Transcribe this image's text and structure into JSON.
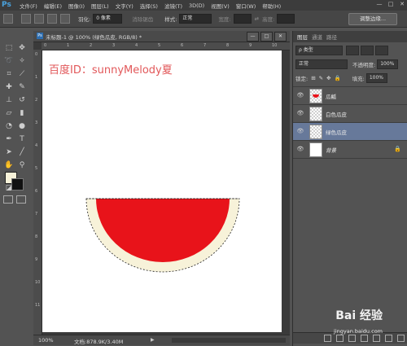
{
  "app": {
    "logo": "Ps"
  },
  "menu": [
    "文件(F)",
    "编辑(E)",
    "图像(I)",
    "图层(L)",
    "文字(Y)",
    "选择(S)",
    "滤镜(T)",
    "3D(D)",
    "视图(V)",
    "窗口(W)",
    "帮助(H)"
  ],
  "window_controls": {
    "minimize": "—",
    "restore": "□",
    "close": "✕"
  },
  "options": {
    "feather_label": "羽化:",
    "feather_value": "0 像素",
    "antialias_label": "消除锯齿",
    "style_label": "样式:",
    "style_value": "正常",
    "width_label": "宽度:",
    "height_label": "高度:",
    "refine_edge": "调整边缘..."
  },
  "document": {
    "tab_title": "未标题-1 @ 100% (绿色瓜皮, RGB/8) *",
    "ruler_top": [
      "0",
      "1",
      "2",
      "3",
      "4",
      "5",
      "6",
      "7",
      "8",
      "9",
      "10"
    ],
    "ruler_left": [
      "0",
      "1",
      "2",
      "3",
      "4",
      "5",
      "6",
      "7",
      "8",
      "9",
      "10",
      "11"
    ],
    "watermark": "百度ID：sunnyMelody夏",
    "zoom": "100%",
    "doc_info": "文档:878.9K/3.40M"
  },
  "layers_panel": {
    "tabs": [
      "图层",
      "通道",
      "路径"
    ],
    "filter_kind": "ρ 类型",
    "blend_mode": "正常",
    "opacity_label": "不透明度:",
    "opacity_value": "100%",
    "lock_label": "锁定:",
    "fill_label": "填充:",
    "fill_value": "100%",
    "layers": [
      {
        "name": "瓜瓤",
        "selected": false
      },
      {
        "name": "白色瓜皮",
        "selected": false
      },
      {
        "name": "绿色瓜皮",
        "selected": true
      },
      {
        "name": "背景",
        "selected": false
      }
    ]
  },
  "watermark_brand": {
    "logo": "Bai 经验",
    "url": "jingyan.baidu.com"
  },
  "colors": {
    "melon_flesh": "#e8131a",
    "rind": "#f7f2d9",
    "selected_layer": "#67799a",
    "watermark_text": "#e2585a"
  }
}
